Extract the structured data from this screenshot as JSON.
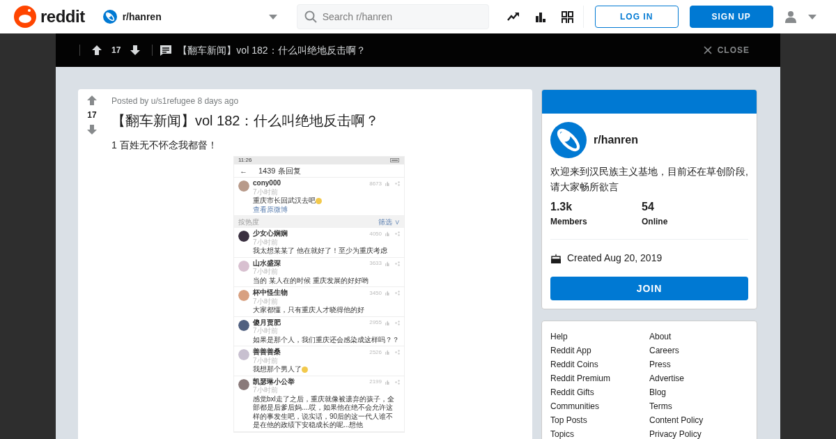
{
  "header": {
    "logo_text": "reddit",
    "community": "r/hanren",
    "search": {
      "placeholder": "Search r/hanren"
    },
    "buttons": [
      {
        "label": "LOG IN",
        "kind": "outline"
      },
      {
        "label": "SIGN UP",
        "kind": "primary"
      }
    ]
  },
  "post_bar": {
    "votes": "17",
    "title": "【翻车新闻】vol 182：什么叫绝地反击啊？",
    "close": "CLOSE"
  },
  "post": {
    "meta": "Posted by u/s1refugee 8 days ago",
    "votes": "17",
    "title": "【翻车新闻】vol 182：什么叫绝地反击啊？",
    "body": "1 百姓无不怀念我都督！",
    "image": {
      "status_time": "11:26",
      "back": "←",
      "header": "1439 条回复",
      "top_comment": {
        "user": "cony000",
        "time": "7小时前",
        "likes": "8673",
        "text": "重庆市长回武汉去吧",
        "emoji": true,
        "link": "查看原微博"
      },
      "sort_label": "按热度",
      "filter": "筛选 ∨",
      "comments": [
        {
          "user": "少女心娴娴",
          "time": "7小时前",
          "likes": "4050",
          "text": "我太想某某了 他在就好了！至少为重庆考虑",
          "emoji": false
        },
        {
          "user": "山水盛深",
          "time": "7小时前",
          "likes": "3633",
          "text": "当的 某人在的时候 重庆发展的好好哟",
          "emoji": false
        },
        {
          "user": "杯中怪生物",
          "time": "7小时前",
          "likes": "3450",
          "text": "大家都懂，只有重庆人才晓得他的好",
          "emoji": false
        },
        {
          "user": "傻月贾肥",
          "time": "7小时前",
          "likes": "2955",
          "text": "如果是那个人，我们重庆还会感染成这样吗？？",
          "emoji": false
        },
        {
          "user": "善善善桑",
          "time": "7小时前",
          "likes": "2526",
          "text": "我想那个男人了",
          "emoji": true
        },
        {
          "user": "凯瑟琳小公举",
          "time": "7小时前",
          "likes": "2199",
          "text": "感觉bxl走了之后，重庆就像被遗弃的孩子，全部都是后爹后妈....哎，如果他在绝不会允许这样的事发生吧，说实话，90后的这一代人谁不是在他的政绩下安稳成长的呢...想他",
          "emoji": false
        }
      ]
    }
  },
  "sidebar": {
    "name": "r/hanren",
    "description": "欢迎来到汉民族主义基地，目前还在草创阶段,请大家畅所欲言",
    "stats": [
      {
        "value": "1.3k",
        "label": "Members"
      },
      {
        "value": "54",
        "label": "Online"
      }
    ],
    "created": "Created Aug 20, 2019",
    "join": "JOIN"
  },
  "footer_links": [
    [
      "Help",
      "Reddit App",
      "Reddit Coins",
      "Reddit Premium",
      "Reddit Gifts",
      "Communities",
      "Top Posts",
      "Topics"
    ],
    [
      "About",
      "Careers",
      "Press",
      "Advertise",
      "Blog",
      "Terms",
      "Content Policy",
      "Privacy Policy"
    ]
  ]
}
